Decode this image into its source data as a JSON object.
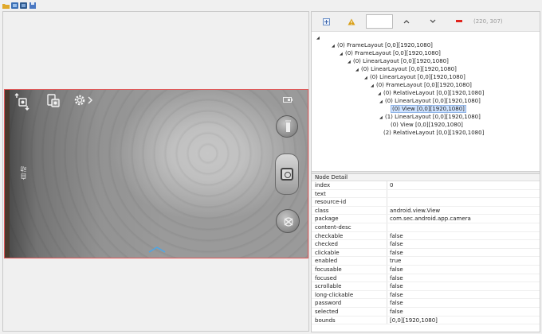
{
  "top_toolbar": {
    "buttons": [
      {
        "icon": "open-folder-icon",
        "color": "#e0a92a"
      },
      {
        "icon": "screenshot-icon",
        "color": "#3a6fb5"
      },
      {
        "icon": "compressed-screenshot-icon",
        "color": "#2e5a8e"
      },
      {
        "icon": "save-icon",
        "color": "#4a78c2"
      }
    ]
  },
  "device": {
    "side_label": "自动",
    "accent_color": "#e05858"
  },
  "tree_toolbar": {
    "buttons": [
      {
        "icon": "expand-all-icon"
      },
      {
        "icon": "warning-icon",
        "color": "#d9a01a"
      },
      {
        "icon": "chevron-up-icon"
      },
      {
        "icon": "chevron-down-icon"
      },
      {
        "icon": "minus-icon",
        "color": "#e0231c"
      }
    ],
    "coords": "(220, 307)"
  },
  "tree": {
    "nodes": [
      {
        "label": "",
        "expanded": true
      },
      {
        "label": "(0) FrameLayout [0,0][1920,1080]",
        "expanded": true
      },
      {
        "label": "(0) FrameLayout [0,0][1920,1080]",
        "expanded": true
      },
      {
        "label": "(0) LinearLayout [0,0][1920,1080]",
        "expanded": true
      },
      {
        "label": "(0) LinearLayout [0,0][1920,1080]",
        "expanded": true
      },
      {
        "label": "(0) LinearLayout [0,0][1920,1080]",
        "expanded": true
      },
      {
        "label": "(0) FrameLayout [0,0][1920,1080]",
        "expanded": true
      },
      {
        "label": "(0) RelativeLayout [0,0][1920,1080]",
        "expanded": true
      },
      {
        "label": "(0) LinearLayout [0,0][1920,1080]",
        "expanded": true
      },
      {
        "label": "(0) View [0,0][1920,1080]",
        "selected": true
      },
      {
        "label": "(1) LinearLayout [0,0][1920,1080]",
        "expanded": true
      },
      {
        "label": "(0) View [0,0][1920,1080]"
      },
      {
        "label": "(2) RelativeLayout [0,0][1920,1080]"
      }
    ]
  },
  "detail": {
    "header": "Node Detail",
    "rows": [
      {
        "key": "index",
        "value": "0"
      },
      {
        "key": "text",
        "value": ""
      },
      {
        "key": "resource-id",
        "value": ""
      },
      {
        "key": "class",
        "value": "android.view.View"
      },
      {
        "key": "package",
        "value": "com.sec.android.app.camera"
      },
      {
        "key": "content-desc",
        "value": ""
      },
      {
        "key": "checkable",
        "value": "false"
      },
      {
        "key": "checked",
        "value": "false"
      },
      {
        "key": "clickable",
        "value": "false"
      },
      {
        "key": "enabled",
        "value": "true"
      },
      {
        "key": "focusable",
        "value": "false"
      },
      {
        "key": "focused",
        "value": "false"
      },
      {
        "key": "scrollable",
        "value": "false"
      },
      {
        "key": "long-clickable",
        "value": "false"
      },
      {
        "key": "password",
        "value": "false"
      },
      {
        "key": "selected",
        "value": "false"
      },
      {
        "key": "bounds",
        "value": "[0,0][1920,1080]"
      }
    ]
  }
}
